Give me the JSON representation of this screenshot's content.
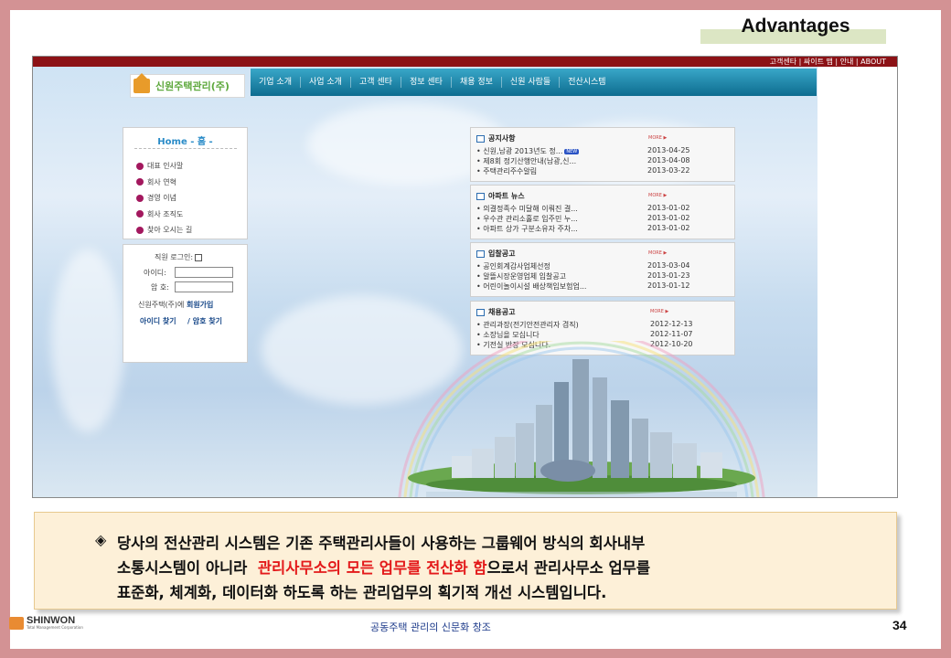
{
  "slide": {
    "title": "Advantages",
    "page_number": "34",
    "footer_text": "공동주택 관리의 신문화 창조",
    "footer_logo": {
      "name": "SHINWON",
      "subtitle": "Total Management Corporation"
    }
  },
  "website": {
    "topbar_links": "고객센타 | 싸이트 맵 | 안내 | ABOUT",
    "logo_text": "신원주택관리(주)",
    "nav": [
      "기업 소개",
      "사업 소개",
      "고객 센타",
      "정보 센타",
      "채용 정보",
      "신원 사람들",
      "전산시스템"
    ],
    "home_menu": {
      "title": "Home - 홈 -",
      "items": [
        "대표 인사말",
        "회사 연혁",
        "경영 이념",
        "회사 조직도",
        "찾아 오시는 길"
      ]
    },
    "login": {
      "title": "직원 로그인:",
      "id_label": "아이디:",
      "pw_label": "암 호:",
      "join_prefix": "신원주택(주)에",
      "join_link": "회원가입",
      "find_id": "아이디 찾기",
      "find_pw": "/ 암호 찾기"
    },
    "panels": [
      {
        "title": "공지사항",
        "more": "MORE ▶",
        "rows": [
          {
            "text": "• 신원,남광 2013년도 정...",
            "date": "2013-04-25",
            "badge": "NEW"
          },
          {
            "text": "• 제8회 정기산행안내(남광,신...",
            "date": "2013-04-08"
          },
          {
            "text": "• 주택관리주수알림",
            "date": "2013-03-22"
          }
        ]
      },
      {
        "title": "아파트 뉴스",
        "more": "MORE ▶",
        "rows": [
          {
            "text": "• 의결정족수 미달해 이뤄진 결...",
            "date": "2013-01-02"
          },
          {
            "text": "• 우수관 관리소홀로 입주민 누...",
            "date": "2013-01-02"
          },
          {
            "text": "• 아파트 상가 구분소유자 주차...",
            "date": "2013-01-02"
          }
        ]
      },
      {
        "title": "입찰공고",
        "more": "MORE ▶",
        "rows": [
          {
            "text": "• 공인회계감사업체선정",
            "date": "2013-03-04"
          },
          {
            "text": "• 알뜰시장운영업체 입찰공고",
            "date": "2013-01-23"
          },
          {
            "text": "• 어린이놀이시설 배상책임보험업...",
            "date": "2013-01-12"
          }
        ]
      },
      {
        "title": "채용공고",
        "more": "MORE ▶",
        "rows": [
          {
            "text": "• 관리과장(전기안전관리자 겸직)",
            "date": "2012-12-13"
          },
          {
            "text": "• 소장님을 모십니다",
            "date": "2012-11-07"
          },
          {
            "text": "• 기전실 반장 모십니다.",
            "date": "2012-10-20"
          }
        ]
      }
    ]
  },
  "note": {
    "bullet": "◈",
    "line1": "당사의 전산관리 시스템은 기존 주택관리사들이 사용하는 그룹웨어 방식의 회사내부",
    "line2_pre": "소통시스템이 아니라",
    "line2_red": "관리사무소의 모든 업무를 전산화 함",
    "line2_post": "으로서 관리사무소 업무를",
    "line3": "표준화, 체계화, 데이터화 하도록 하는 관리업무의 획기적 개선 시스템입니다."
  },
  "colors": {
    "frame": "#d39294",
    "topbar": "#8c1216",
    "nav": "#1a84a8",
    "highlight": "#e3191a",
    "note_bg": "#fdf0d8"
  }
}
